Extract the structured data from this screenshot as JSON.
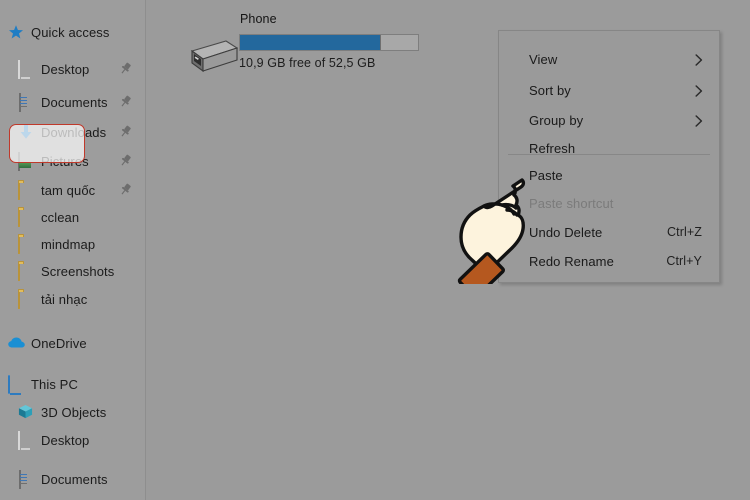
{
  "colors": {
    "background": "#9b9b9b",
    "nav_background": "#9d9d9d",
    "menu_background": "#9a9a9a",
    "accent_blue": "#23689d",
    "highlight_red": "#c0392b",
    "folder_yellow": "#e3bd5a",
    "text": "#1a1a1a",
    "text_disabled": "#7b7b7b",
    "hand_fill": "#fdf3dd",
    "cuff_orange": "#b5581f"
  },
  "nav_pane": {
    "items": [
      {
        "label": "Quick access",
        "icon": "star-icon",
        "level": 0,
        "pinned": false
      },
      {
        "label": "Desktop",
        "icon": "desktop-icon",
        "level": 1,
        "pinned": true
      },
      {
        "label": "Documents",
        "icon": "document-icon",
        "level": 1,
        "pinned": true
      },
      {
        "label": "Downloads",
        "icon": "download-icon",
        "level": 1,
        "pinned": true
      },
      {
        "label": "Pictures",
        "icon": "pictures-icon",
        "level": 1,
        "pinned": true
      },
      {
        "label": "tam quốc",
        "icon": "folder-icon",
        "level": 1,
        "pinned": true
      },
      {
        "label": "cclean",
        "icon": "folder-icon",
        "level": 1,
        "pinned": false
      },
      {
        "label": "mindmap",
        "icon": "folder-icon",
        "level": 1,
        "pinned": false
      },
      {
        "label": "Screenshots",
        "icon": "folder-icon",
        "level": 1,
        "pinned": false
      },
      {
        "label": "tải nhạc",
        "icon": "folder-icon",
        "level": 1,
        "pinned": false
      },
      {
        "label": "OneDrive",
        "icon": "cloud-icon",
        "level": 0,
        "pinned": false
      },
      {
        "label": "This PC",
        "icon": "computer-icon",
        "level": 0,
        "pinned": false
      },
      {
        "label": "3D Objects",
        "icon": "cube-icon",
        "level": 1,
        "pinned": false
      },
      {
        "label": "Desktop",
        "icon": "desktop-icon",
        "level": 1,
        "pinned": false
      },
      {
        "label": "Documents",
        "icon": "document-icon",
        "level": 1,
        "pinned": false
      }
    ]
  },
  "drive": {
    "name": "Phone",
    "capacity_text": "10,9 GB free of 52,5 GB",
    "used_percent": 79,
    "icon": "portable-drive-icon"
  },
  "context_menu": {
    "items": [
      {
        "label": "View",
        "accel": "",
        "submenu": true,
        "disabled": false
      },
      {
        "label": "Sort by",
        "accel": "",
        "submenu": true,
        "disabled": false
      },
      {
        "label": "Group by",
        "accel": "",
        "submenu": true,
        "disabled": false
      },
      {
        "label": "Refresh",
        "accel": "",
        "submenu": false,
        "disabled": false
      },
      {
        "label": "Paste",
        "accel": "",
        "submenu": false,
        "disabled": false
      },
      {
        "label": "Paste shortcut",
        "accel": "",
        "submenu": false,
        "disabled": true
      },
      {
        "label": "Undo Delete",
        "accel": "Ctrl+Z",
        "submenu": false,
        "disabled": false
      },
      {
        "label": "Redo Rename",
        "accel": "Ctrl+Y",
        "submenu": false,
        "disabled": false
      }
    ],
    "highlighted_item": "Paste"
  },
  "cursor": {
    "type": "pointing-hand-illustration"
  }
}
